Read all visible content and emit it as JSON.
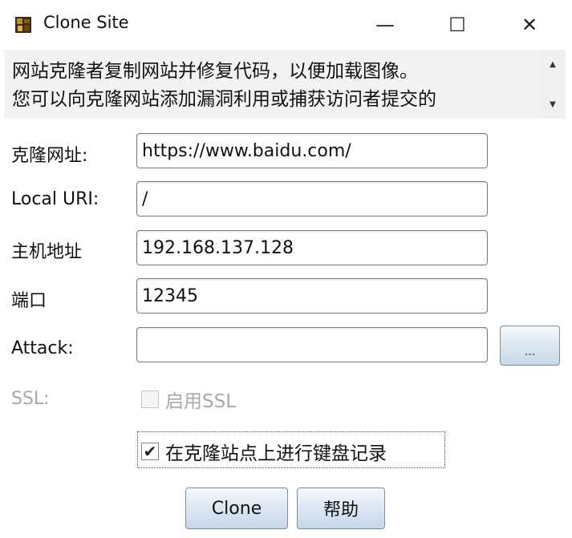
{
  "window": {
    "title": "Clone Site",
    "minimize": "—",
    "maximize": "☐",
    "close": "✕"
  },
  "description": {
    "line1": "网站克隆者复制网站并修复代码，以便加载图像。",
    "line2": "您可以向克隆网站添加漏洞利用或捕获访问者提交的"
  },
  "form": {
    "clone_url_label": "克隆网址:",
    "clone_url_value": "https://www.baidu.com/",
    "local_uri_label": "Local URI:",
    "local_uri_value": "/",
    "host_label": "主机地址",
    "host_value": "192.168.137.128",
    "port_label": "端口",
    "port_value": "12345",
    "attack_label": "Attack:",
    "attack_value": "",
    "browse_label": "...",
    "ssl_label": "SSL:",
    "ssl_checkbox_label": "启用SSL",
    "ssl_checked": false,
    "keylog_label": "在克隆站点上进行键盘记录",
    "keylog_checked": true
  },
  "buttons": {
    "clone": "Clone",
    "help": "帮助"
  },
  "icons": {
    "app": "java-cup-icon",
    "scroll_up": "▲",
    "scroll_down": "▼",
    "check": "✔"
  }
}
